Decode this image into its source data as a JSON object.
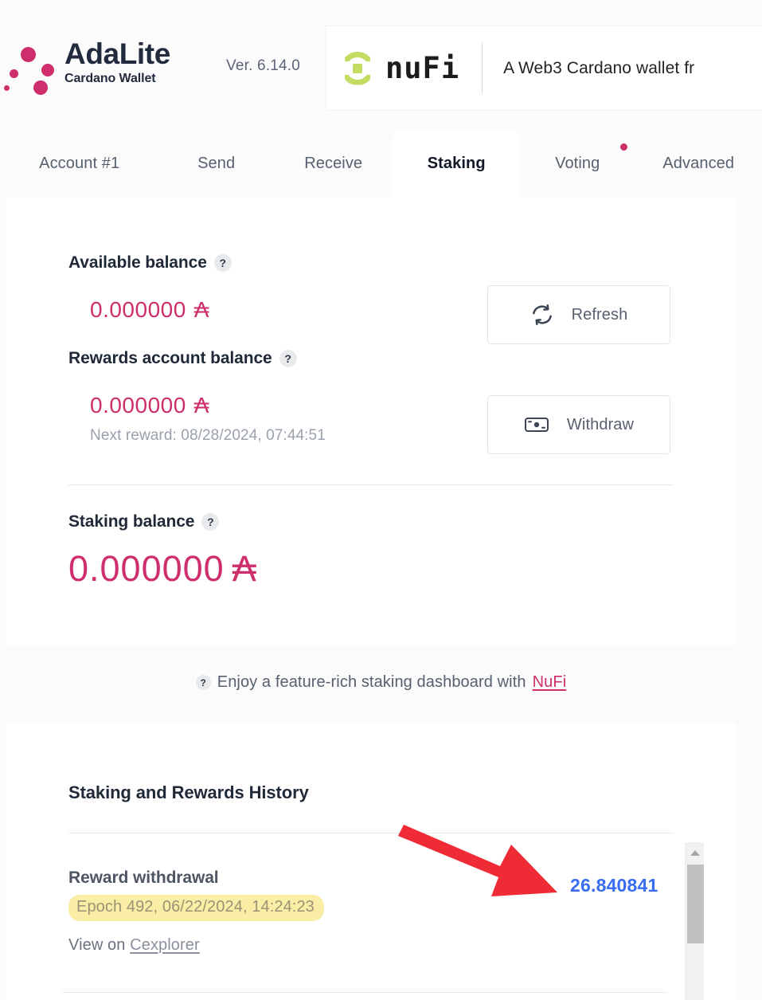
{
  "app": {
    "brand_name": "AdaLite",
    "brand_subtitle": "Cardano Wallet",
    "version": "Ver. 6.14.0"
  },
  "promo_banner": {
    "logo_text": "nuFi",
    "tagline": "A Web3 Cardano wallet fr"
  },
  "tabs": [
    {
      "label": "Account #1",
      "active": false,
      "badge": false
    },
    {
      "label": "Send",
      "active": false,
      "badge": false
    },
    {
      "label": "Receive",
      "active": false,
      "badge": false
    },
    {
      "label": "Staking",
      "active": true,
      "badge": false
    },
    {
      "label": "Voting",
      "active": false,
      "badge": true
    },
    {
      "label": "Advanced",
      "active": false,
      "badge": false
    }
  ],
  "balances": {
    "available": {
      "label": "Available balance",
      "help": "?",
      "value": "0.000000",
      "symbol": "₳"
    },
    "rewards": {
      "label": "Rewards account balance",
      "help": "?",
      "value": "0.000000",
      "symbol": "₳",
      "next_reward": "Next reward: 08/28/2024, 07:44:51"
    },
    "staking": {
      "label": "Staking balance",
      "help": "?",
      "value": "0.000000",
      "symbol": "₳"
    }
  },
  "actions": {
    "refresh_label": "Refresh",
    "withdraw_label": "Withdraw"
  },
  "promo_line": {
    "help": "?",
    "text": "Enjoy a feature-rich staking dashboard with",
    "link": "NuFi"
  },
  "history": {
    "title": "Staking and Rewards History",
    "rows": [
      {
        "type": "Reward withdrawal",
        "epoch": "Epoch 492, 06/22/2024, 14:24:23",
        "view_prefix": "View on",
        "view_link": "Cexplorer",
        "amount": "26.840841"
      }
    ]
  },
  "colors": {
    "accent_pink": "#cf2e6c",
    "amount_blue": "#386cf1",
    "highlight_yellow": "#faeea6",
    "nufi_green": "#c3dc62",
    "annotation_red": "#ef2b35"
  }
}
